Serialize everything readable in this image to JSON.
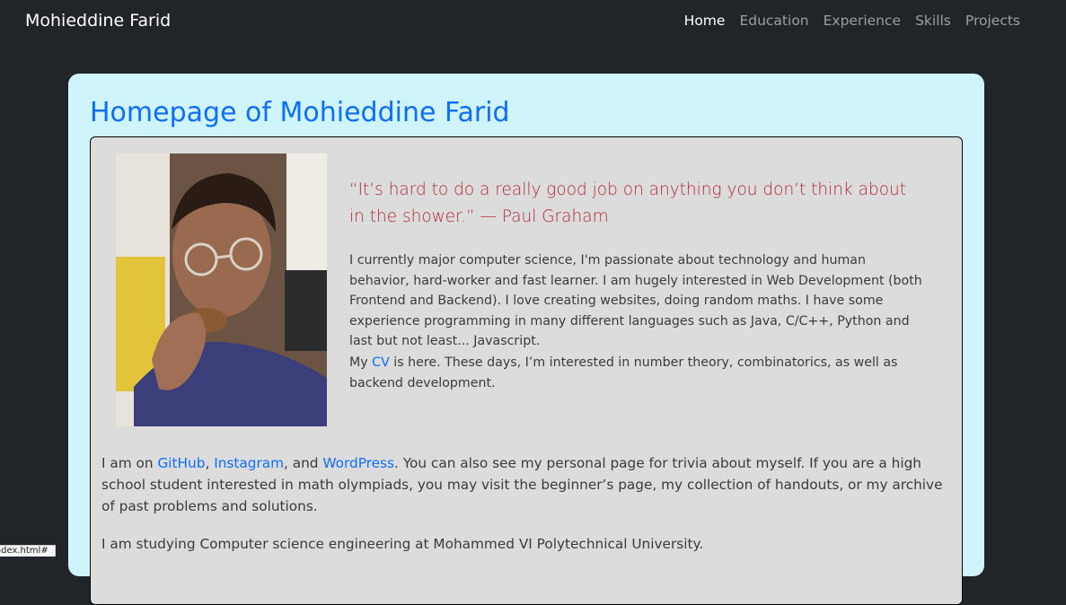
{
  "navbar": {
    "brand": "Mohieddine Farid",
    "links": [
      "Home",
      "Education",
      "Experience",
      "Skills",
      "Projects"
    ],
    "active": "Home"
  },
  "main": {
    "title": "Homepage of Mohieddine Farid",
    "quote": "“It’s hard to do a really good job on anything you don’t think about in the shower.” — Paul Graham",
    "bio": "I currently major computer science, I'm passionate about technology and human behavior, hard-worker and fast learner. I am hugely interested in Web Development (both Frontend and Backend). I love creating websites, doing random maths. I have some experience programming in many different languages such as Java, C/C++, Python and last but not least... Javascript.",
    "cv_prefix": "My ",
    "cv_link": "CV",
    "cv_suffix": " is here. These days, I’m interested in number theory, combinatorics, as well as backend development.",
    "links_prefix": "I am on ",
    "github": "GitHub",
    "sep1": ", ",
    "instagram": "Instagram",
    "sep2": ", and ",
    "wordpress": "WordPress",
    "links_suffix": ". You can also see my personal page for trivia about myself. If you are a high school student interested in math olympiads, you may visit the beginner’s page, my collection of handouts, or my archive of past problems and solutions.",
    "study": "I am studying Computer science engineering at Mohammed VI Polytechnical University."
  },
  "status_bar": {
    "url": "index.html#"
  },
  "colors": {
    "background": "#212529",
    "card": "#cff4fc",
    "inner": "#dcdcdc",
    "link": "#0d6efd",
    "quote": "#b02a37"
  }
}
